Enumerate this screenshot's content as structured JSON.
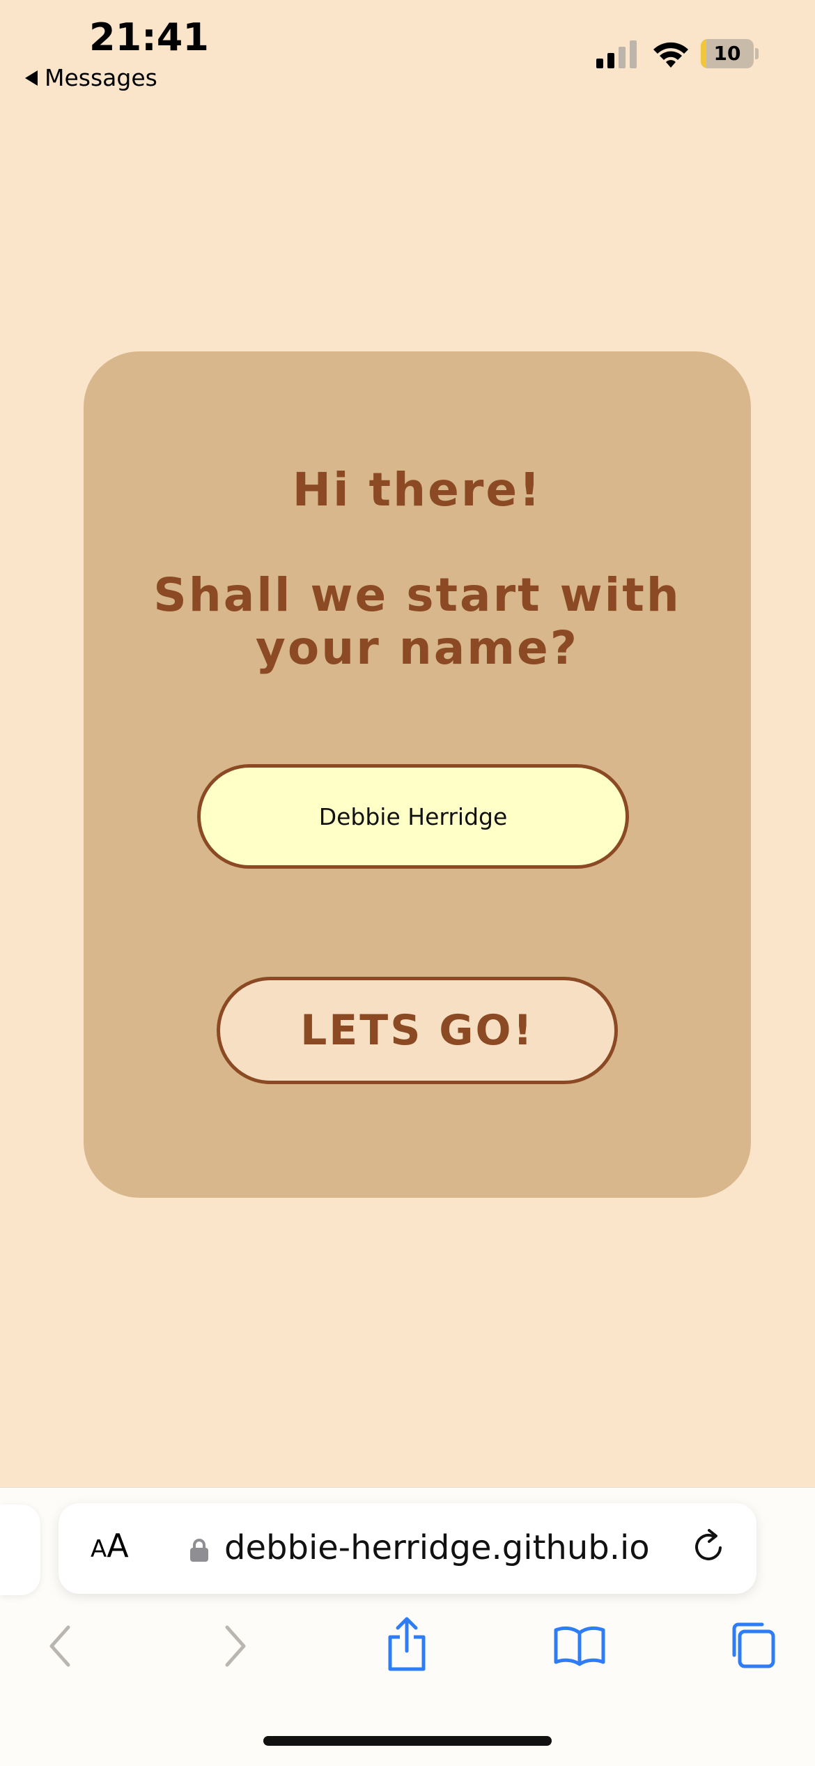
{
  "status_bar": {
    "time": "21:41",
    "back_label": "Messages",
    "battery_level": "10",
    "battery_fraction": 0.1
  },
  "card": {
    "greeting": "Hi there!",
    "prompt_line1": "Shall we start with",
    "prompt_line2": "your name?",
    "name_value": "Debbie Herridge",
    "go_button_label": "LETS GO!"
  },
  "browser": {
    "text_size_small": "A",
    "text_size_big": "A",
    "url": "debbie-herridge.github.io"
  },
  "colors": {
    "page_background": "#FAE5CB",
    "card_background": "#D8B78C",
    "accent_brown": "#8B4A23",
    "input_background": "#FFFFC8",
    "button_background": "#F7DFC3",
    "ios_blue": "#2E7CF6"
  },
  "icons": [
    "back-arrow-icon",
    "signal-icon",
    "wifi-icon",
    "battery-icon",
    "lock-icon",
    "reload-icon",
    "back-icon",
    "forward-icon",
    "share-icon",
    "bookmarks-icon",
    "tabs-icon"
  ]
}
